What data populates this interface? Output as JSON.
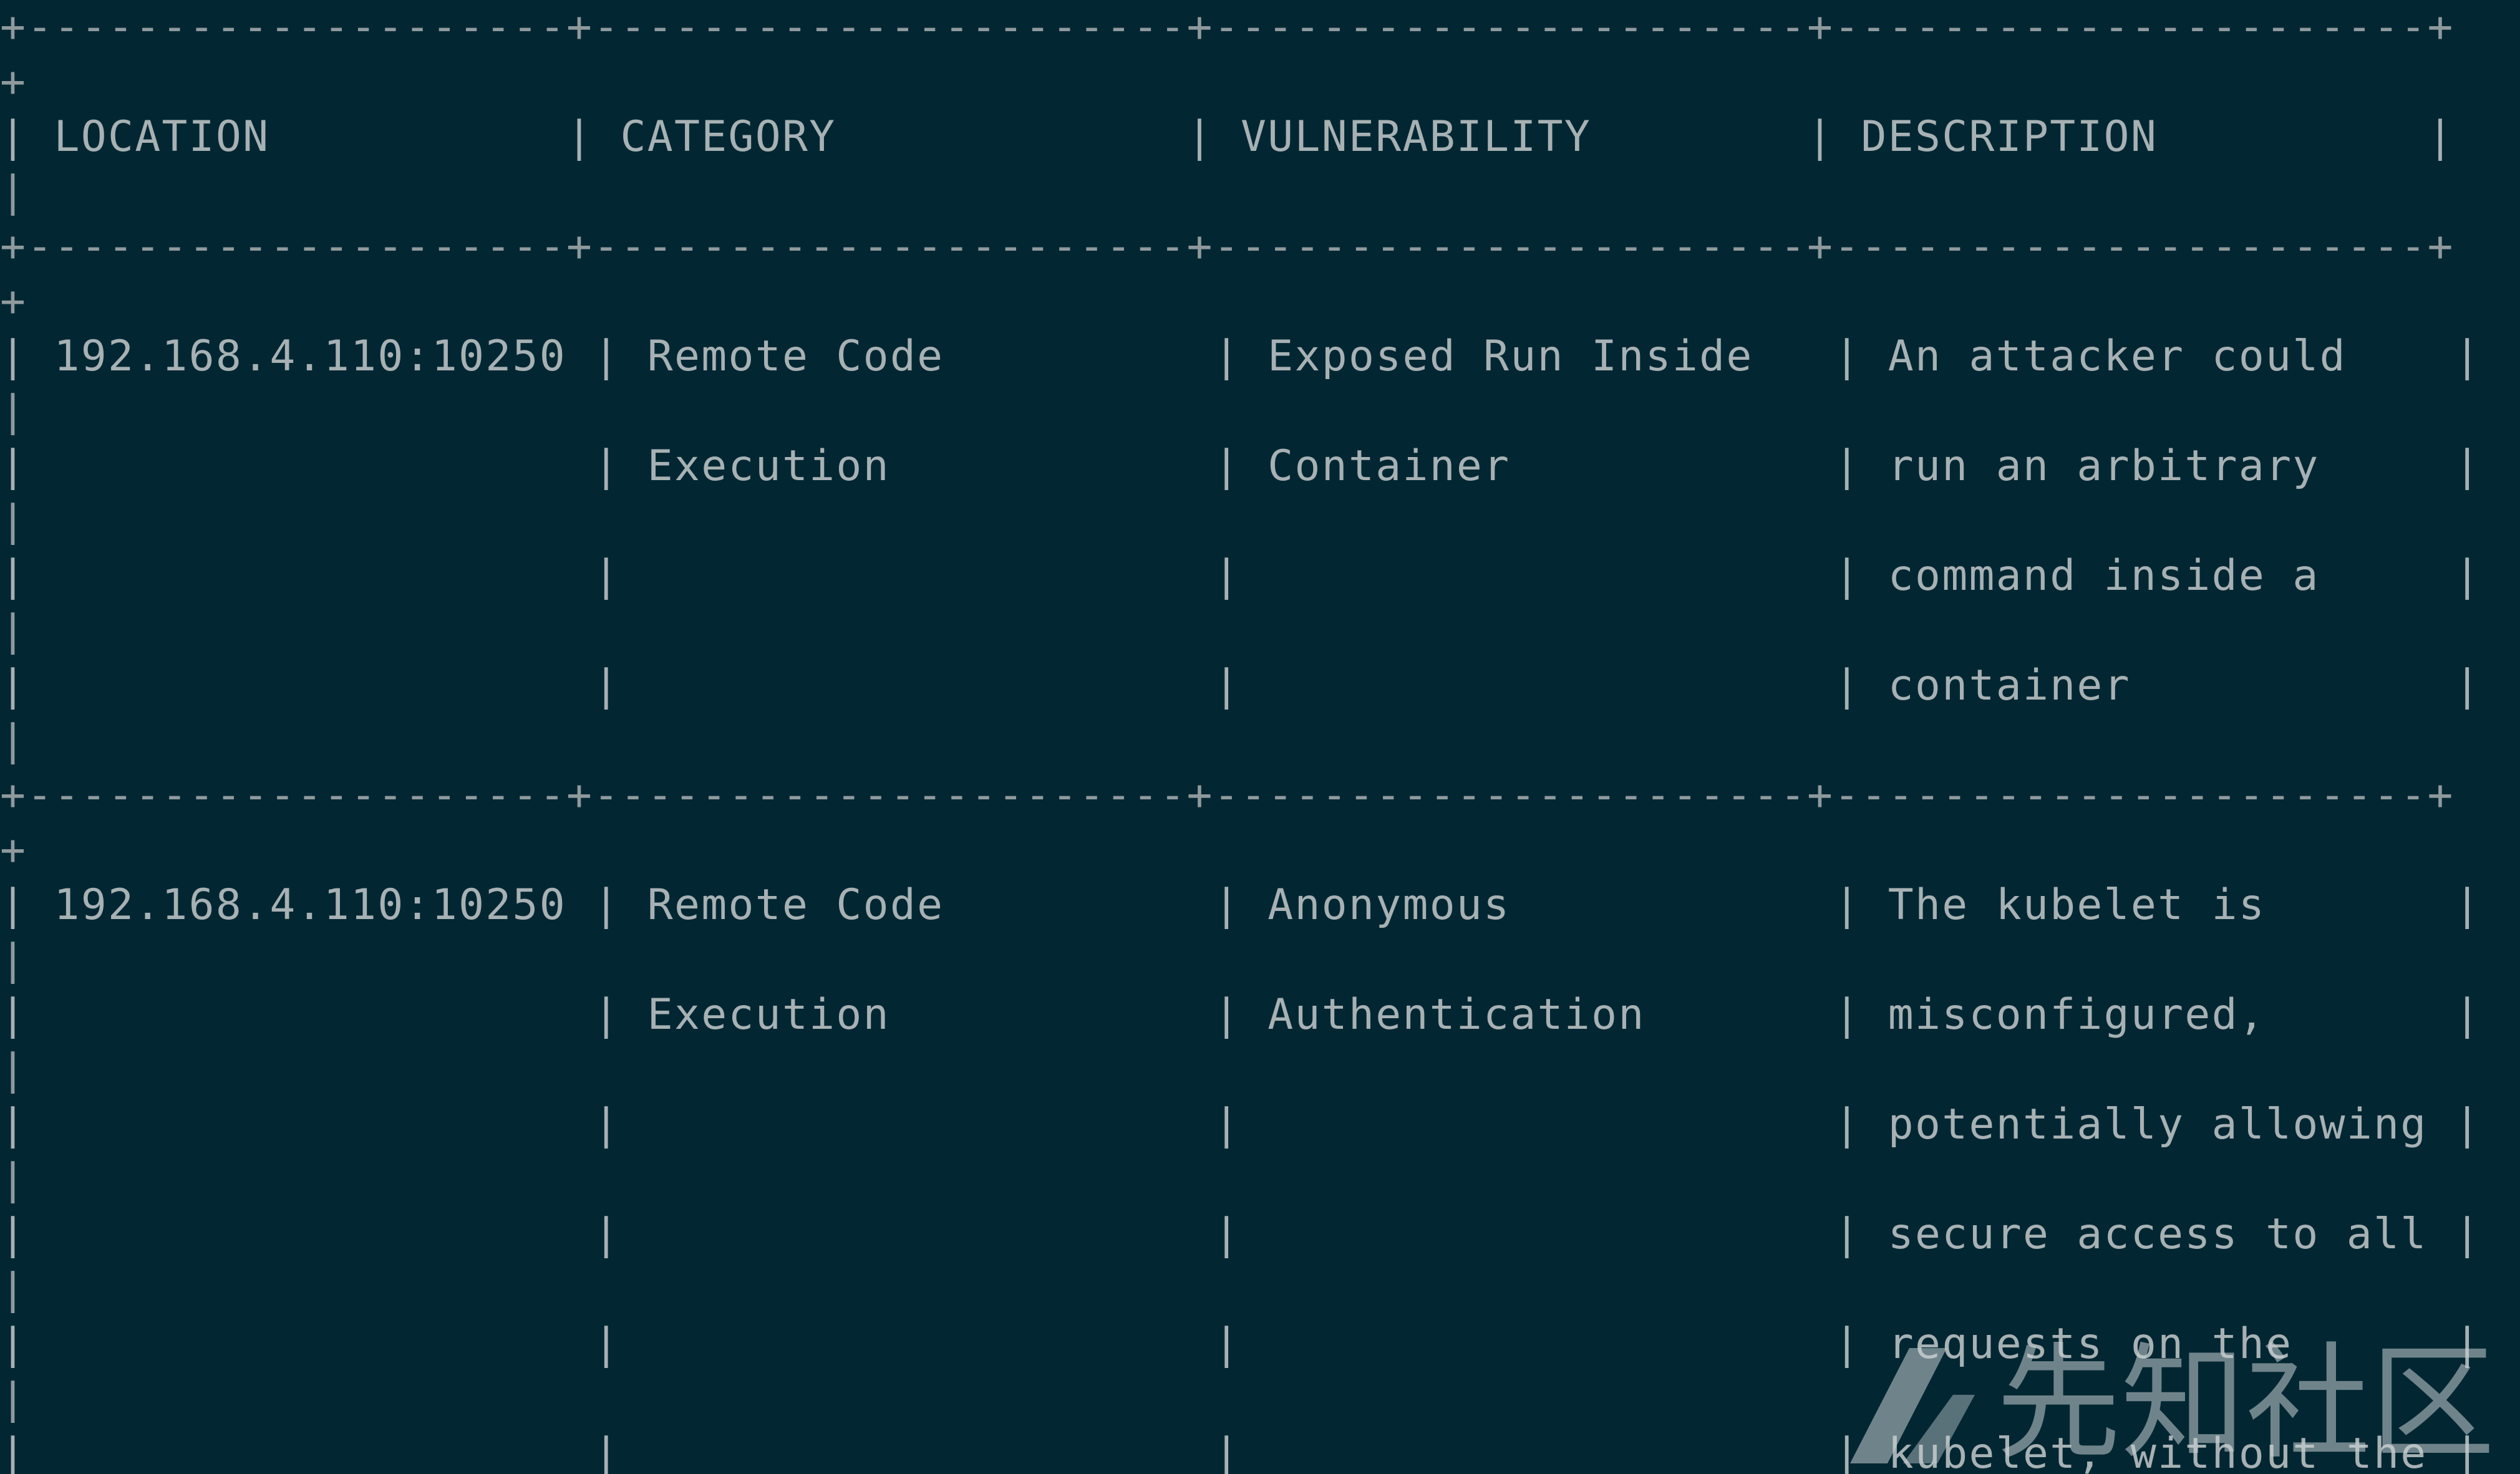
{
  "table": {
    "lines": [
      "+--------------------+----------------------+----------------------+----------------------+",
      "+",
      "| LOCATION           | CATEGORY             | VULNERABILITY        | DESCRIPTION          |",
      "|",
      "+--------------------+----------------------+----------------------+----------------------+",
      "+",
      "| 192.168.4.110:10250 | Remote Code          | Exposed Run Inside   | An attacker could    |",
      "|",
      "|                     | Execution            | Container            | run an arbitrary     |",
      "|",
      "|                     |                      |                      | command inside a     |",
      "|",
      "|                     |                      |                      | container            |",
      "|",
      "+--------------------+----------------------+----------------------+----------------------+",
      "+",
      "| 192.168.4.110:10250 | Remote Code          | Anonymous            | The kubelet is       |",
      "|",
      "|                     | Execution            | Authentication       | misconfigured,       |",
      "|",
      "|                     |                      |                      | potentially allowing |",
      "|",
      "|                     |                      |                      | secure access to all |",
      "|",
      "|                     |                      |                      | requests on the      |",
      "|",
      "|                     |                      |                      | kubelet, without the |"
    ]
  },
  "watermark": {
    "text": "先知社区",
    "icon": "xianzhi-logo-icon"
  },
  "colors": {
    "background": "#022733",
    "text": "#a7b1b3"
  }
}
